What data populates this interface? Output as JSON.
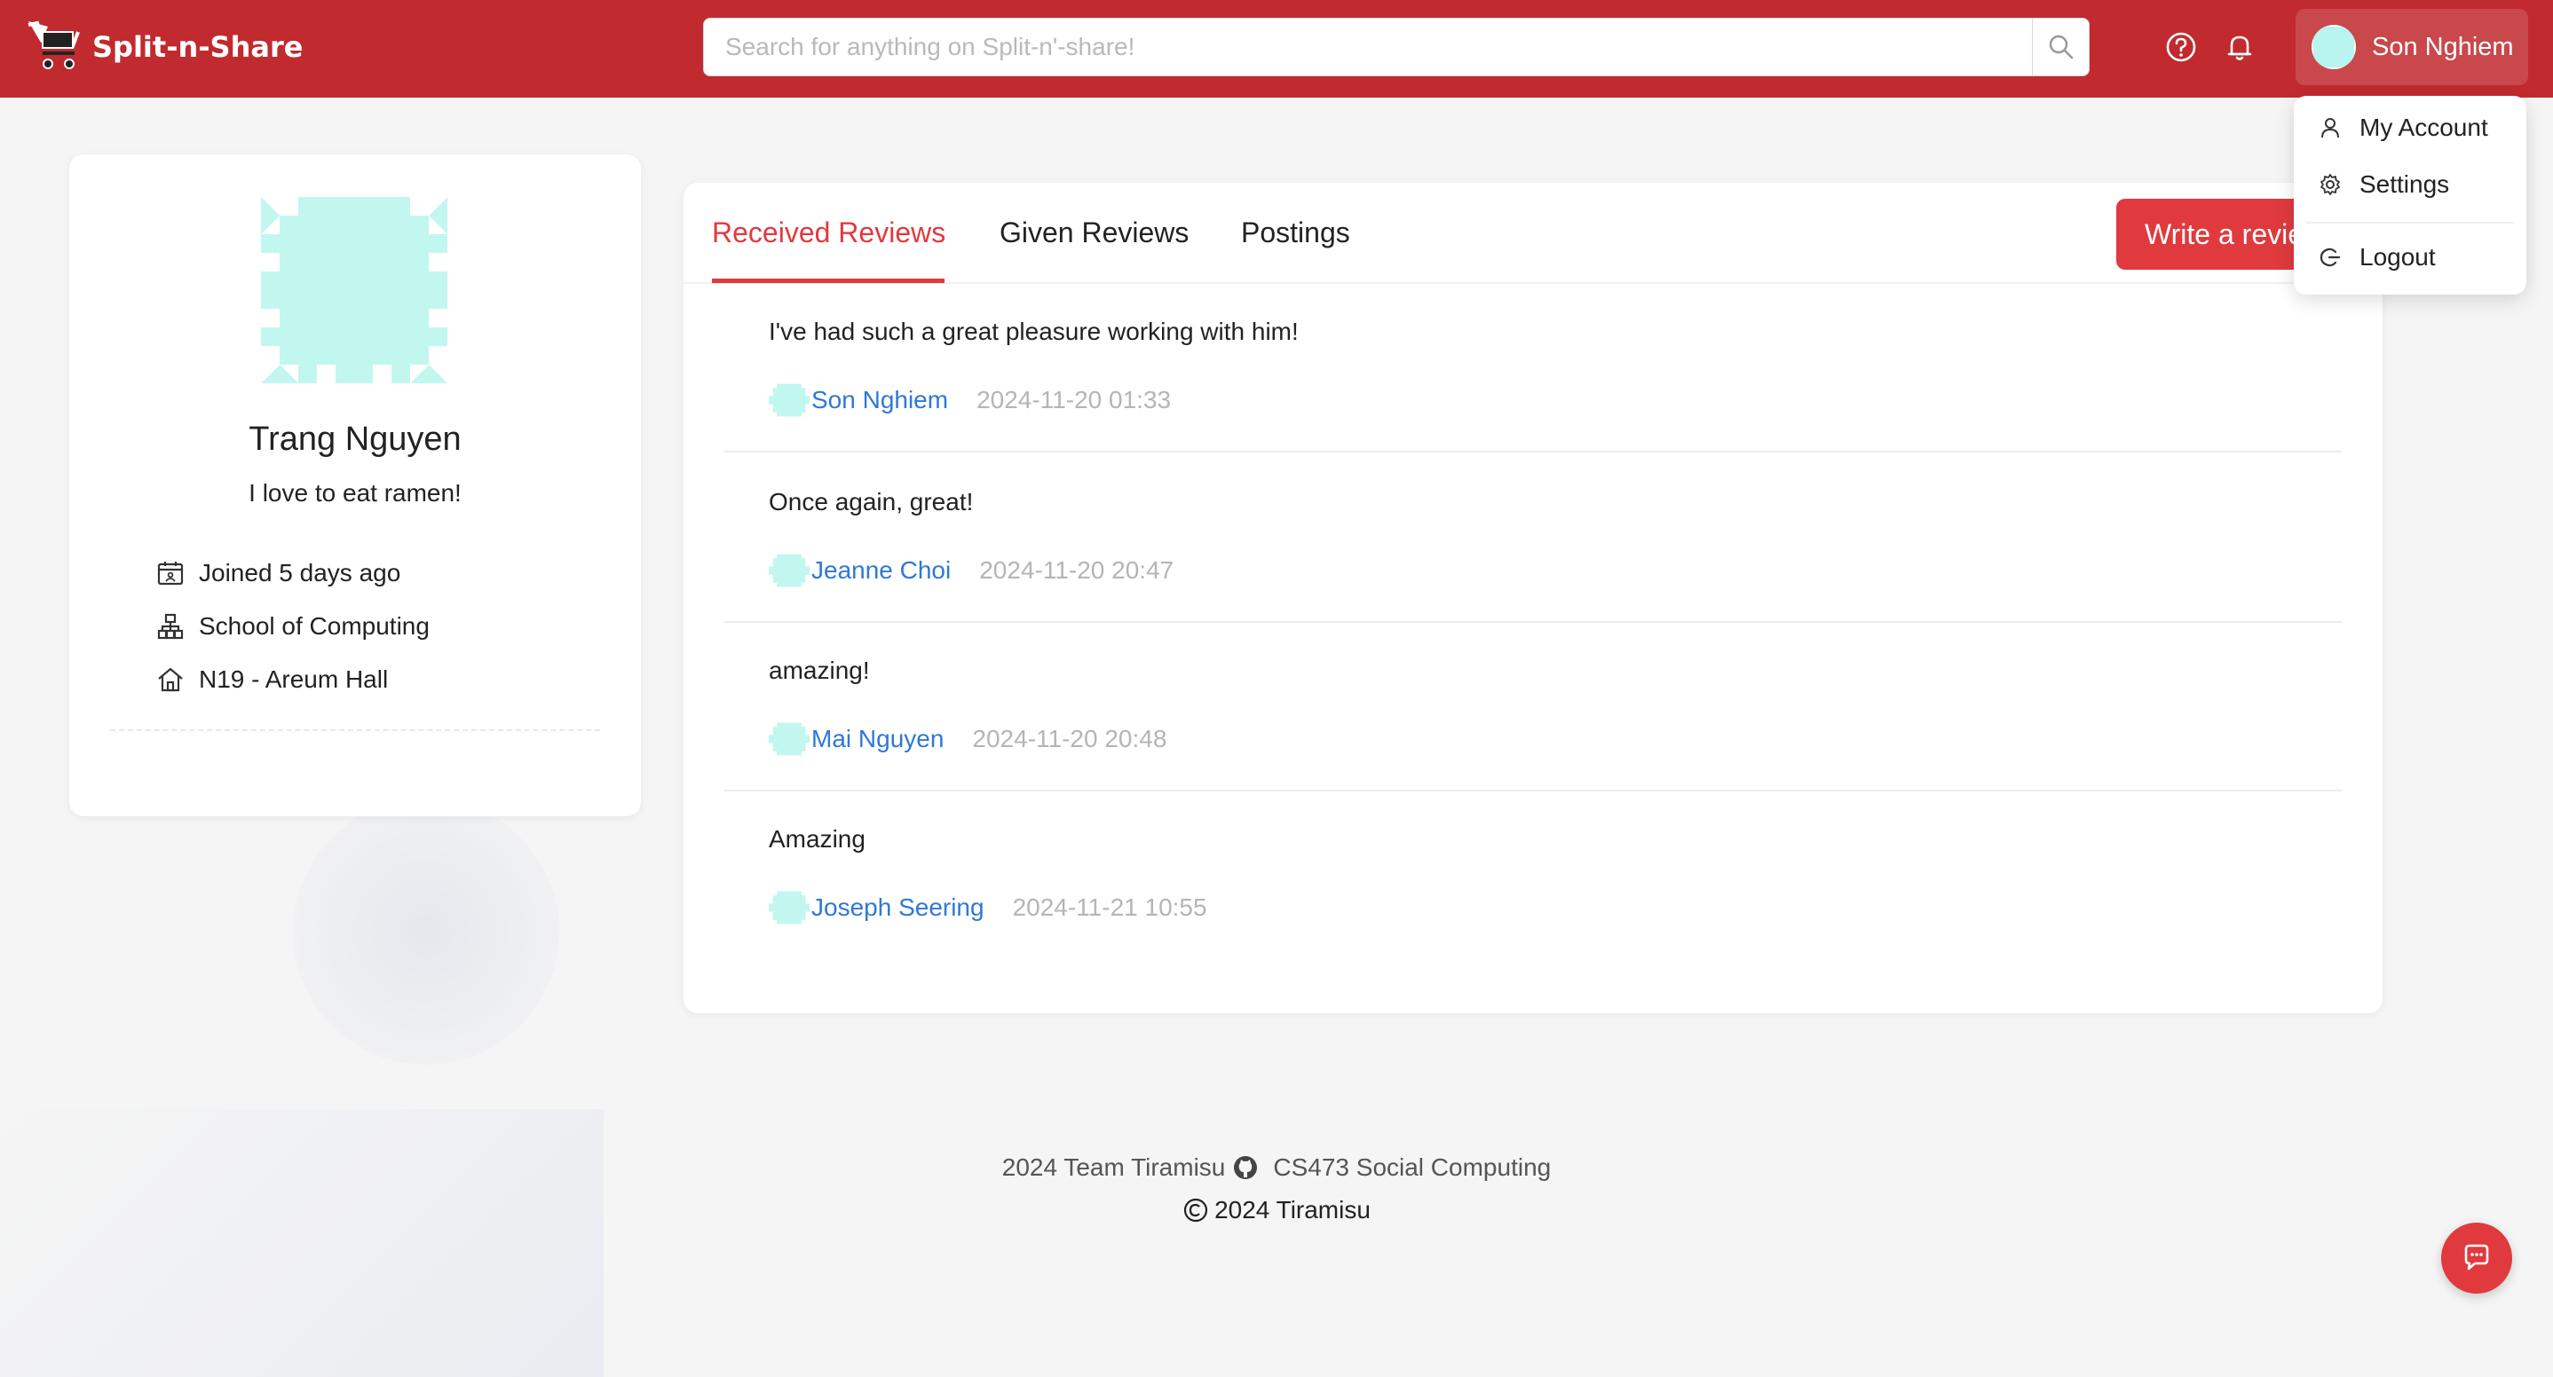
{
  "app": {
    "name": "Split-n-Share"
  },
  "search": {
    "placeholder": "Search for anything on Split-n'-share!"
  },
  "header": {
    "user_name": "Son Nghiem"
  },
  "profile": {
    "name": "Trang Nguyen",
    "bio": "I love to eat ramen!",
    "info": [
      {
        "icon": "calendar-icon",
        "text": "Joined 5 days ago"
      },
      {
        "icon": "org-chart-icon",
        "text": "School of Computing"
      },
      {
        "icon": "home-icon",
        "text": "N19 - Areum Hall"
      }
    ]
  },
  "tabs": [
    {
      "label": "Received Reviews",
      "active": true
    },
    {
      "label": "Given Reviews",
      "active": false
    },
    {
      "label": "Postings",
      "active": false
    }
  ],
  "write_review_label": "Write a review",
  "reviews": [
    {
      "text": "I've had such a great pleasure working with him!",
      "author": "Son Nghiem",
      "date": "2024-11-20 01:33"
    },
    {
      "text": "Once again, great!",
      "author": "Jeanne Choi",
      "date": "2024-11-20 20:47"
    },
    {
      "text": "amazing!",
      "author": "Mai Nguyen",
      "date": "2024-11-20 20:48"
    },
    {
      "text": "Amazing",
      "author": "Joseph Seering",
      "date": "2024-11-21 10:55"
    }
  ],
  "dropdown": {
    "items": [
      {
        "icon": "user-icon",
        "label": "My Account"
      },
      {
        "icon": "gear-icon",
        "label": "Settings"
      },
      {
        "icon": "logout-icon",
        "label": "Logout"
      }
    ]
  },
  "footer": {
    "team": "2024 Team Tiramisu",
    "course": "CS473 Social Computing",
    "copyright": "2024 Tiramisu"
  },
  "colors": {
    "header": "#c12a2e",
    "accent": "#e03a3e",
    "link": "#2f78d8",
    "avatar": "#b7f5ee"
  }
}
